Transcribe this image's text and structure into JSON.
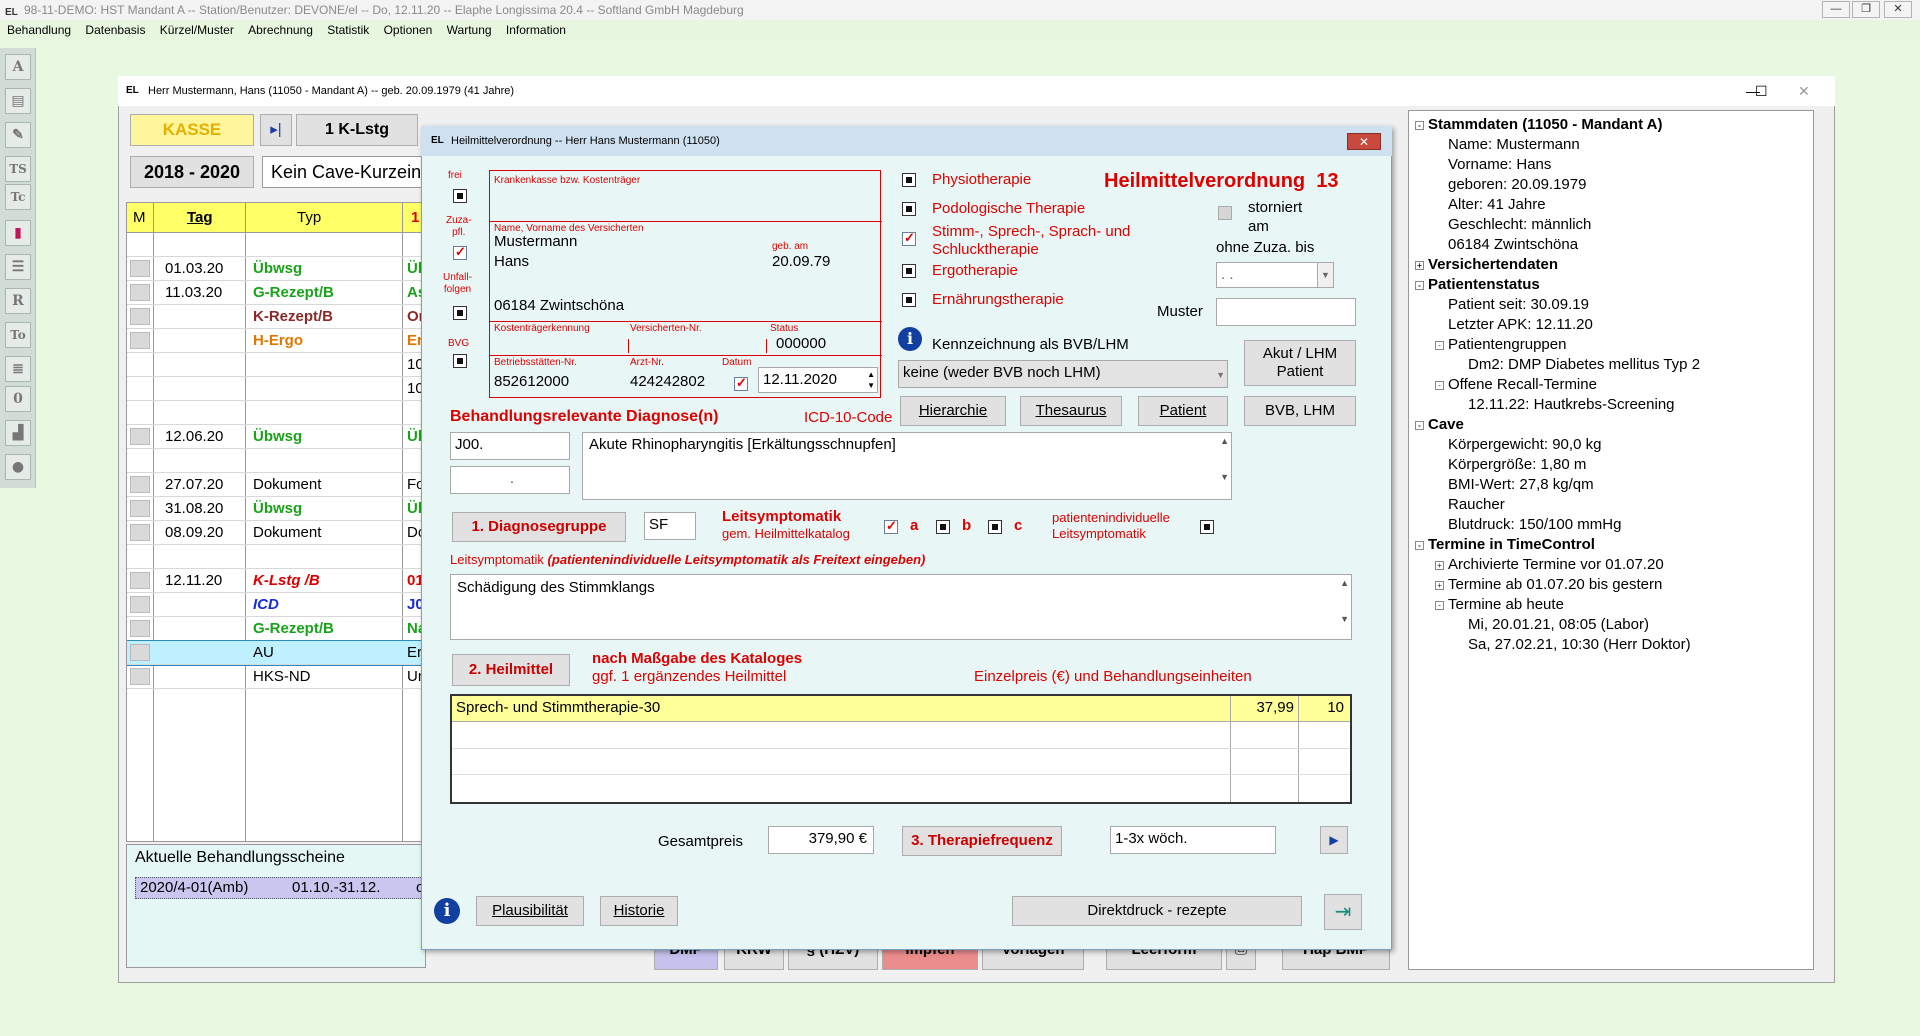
{
  "app": {
    "title": "98-11-DEMO: HST Mandant A -- Station/Benutzer: DEVONE/el -- Do, 12.11.20 -- Elaphe Longissima 20.4 -- Softland GmbH Magdeburg",
    "logo": "EL"
  },
  "menu": [
    "Behandlung",
    "Datenbasis",
    "Kürzel/Muster",
    "Abrechnung",
    "Statistik",
    "Optionen",
    "Wartung",
    "Information"
  ],
  "left_tools": [
    "A",
    "TS",
    "Tc",
    "R",
    "To",
    "0"
  ],
  "patient_window": {
    "title": "Herr Mustermann, Hans (11050 - Mandant A) -- geb. 20.09.1979 (41 Jahre)"
  },
  "top_buttons": {
    "kasse": "KASSE",
    "nav": "▸|",
    "klstg": "1 K-Lstg"
  },
  "years": "2018 - 2020",
  "cave": "Kein Cave-Kurzeintrag",
  "table": {
    "headers": [
      "M",
      "Tag",
      "Typ",
      "1"
    ],
    "rows": [
      {
        "tag": "",
        "typ": "",
        "c": ""
      },
      {
        "tag": "01.03.20",
        "typ": "Übwsg",
        "c": "Üb"
      },
      {
        "tag": "11.03.20",
        "typ": "G-Rezept/B",
        "c": "As"
      },
      {
        "tag": "",
        "typ": "K-Rezept/B",
        "c": "Or"
      },
      {
        "tag": "",
        "typ": "H-Ergo",
        "c": "Er"
      },
      {
        "tag": "",
        "typ": "",
        "c": "10"
      },
      {
        "tag": "",
        "typ": "",
        "c": "10"
      },
      {
        "tag": "",
        "typ": "",
        "c": ""
      },
      {
        "tag": "12.06.20",
        "typ": "Übwsg",
        "c": "Üb"
      },
      {
        "tag": "",
        "typ": "",
        "c": ""
      },
      {
        "tag": "27.07.20",
        "typ": "Dokument",
        "c": "Fo"
      },
      {
        "tag": "31.08.20",
        "typ": "Übwsg",
        "c": "Üb"
      },
      {
        "tag": "08.09.20",
        "typ": "Dokument",
        "c": "Do"
      },
      {
        "tag": "",
        "typ": "",
        "c": ""
      },
      {
        "tag": "12.11.20",
        "typ": "K-Lstg /B",
        "c": "01"
      },
      {
        "tag": "",
        "typ": "ICD",
        "c": "J0"
      },
      {
        "tag": "",
        "typ": "G-Rezept/B",
        "c": "Na"
      },
      {
        "tag": "",
        "typ": "AU",
        "c": "Er"
      },
      {
        "tag": "",
        "typ": "HKS-ND",
        "c": "Un"
      }
    ]
  },
  "scheine": {
    "label": "Aktuelle Behandlungsscheine",
    "value": "2020/4-01(Amb)",
    "range": "01.10.-31.12.",
    "extra": "ol"
  },
  "bottom_buttons": [
    "DMP",
    "KRW",
    "§ (HZV)",
    "Impfen",
    "Vorlagen",
    "Leerform",
    "",
    "Hap BMP"
  ],
  "dialog": {
    "title": "Heilmittelverordnung -- Herr Hans Mustermann (11050)",
    "frei": "frei",
    "zuza": "Zuza-\npfl.",
    "unfall": "Unfall-\nfolgen",
    "bvg": "BVG",
    "kk_label": "Krankenkasse bzw. Kostenträger",
    "name_label": "Name, Vorname des Versicherten",
    "lastname": "Mustermann",
    "firstname": "Hans",
    "geb_label": "geb. am",
    "geb": "20.09.79",
    "address": "06184 Zwintschöna",
    "ktk_label": "Kostenträgerkennung",
    "vnr_label": "Versicherten-Nr.",
    "status_label": "Status",
    "status": "000000",
    "bsnr_label": "Betriebsstätten-Nr.",
    "arzt_label": "Arzt-Nr.",
    "datum_label": "Datum",
    "bsnr": "852612000",
    "arzt": "424242802",
    "datum": "12.11.2020",
    "types": [
      "Physiotherapie",
      "Podologische Therapie",
      "Stimm-, Sprech-, Sprach- und Schlucktherapie",
      "Ergotherapie",
      "Ernährungstherapie"
    ],
    "heading": "Heilmittelverordnung",
    "heading_no": "13",
    "storniert": "storniert\nam",
    "ohne_zuza": "ohne Zuza. bis",
    "date_placeholder": ". .",
    "muster": "Muster",
    "kennz": "Kennzeichnung als BVB/LHM",
    "kennz_value": "keine (weder BVB noch LHM)",
    "akut": "Akut / LHM\nPatient",
    "hierarchie": "Hierarchie",
    "thesaurus": "Thesaurus",
    "patient_btn": "Patient",
    "bvb": "BVB, LHM",
    "diag_label": "Behandlungsrelevante Diagnose(n)",
    "icd_label": "ICD-10-Code",
    "icd1": "J00.",
    "icd2": ".",
    "diag_text": "Akute Rhinopharyngitis [Erkältungsschnupfen]",
    "diaggruppe": "1. Diagnosegruppe",
    "dg_value": "SF",
    "leit_label": "Leitsymptomatik",
    "leit_sub": "gem. Heilmittelkatalog",
    "a": "a",
    "b": "b",
    "c": "c",
    "pat_ind": "patientenindividuelle\nLeitsymptomatik",
    "leit_free_label": "Leitsymptomatik",
    "leit_free_hint": "(patientenindividuelle Leitsymptomatik als Freitext eingeben)",
    "leit_text": "Schädigung des Stimmklangs",
    "heilmittel_btn": "2. Heilmittel",
    "nach": "nach Maßgabe des Kataloges",
    "ggf": "ggf. 1 ergänzendes Heilmittel",
    "einzel": "Einzelpreis (€) und Behandlungseinheiten",
    "items": [
      {
        "name": "Sprech- und Stimmtherapie-30",
        "price": "37,99",
        "units": "10"
      }
    ],
    "gesamt_label": "Gesamtpreis",
    "gesamt": "379,90 €",
    "freq_btn": "3. Therapiefrequenz",
    "freq": "1-3x wöch.",
    "plaus": "Plausibilität",
    "historie": "Historie",
    "direkt": "Direktdruck - rezepte"
  },
  "tree": [
    {
      "l": 0,
      "t": "Stammdaten (11050 - Mandant A)",
      "b": true,
      "e": "-"
    },
    {
      "l": 1,
      "t": "Name: Mustermann"
    },
    {
      "l": 1,
      "t": "Vorname: Hans"
    },
    {
      "l": 1,
      "t": "geboren: 20.09.1979"
    },
    {
      "l": 1,
      "t": "Alter: 41 Jahre"
    },
    {
      "l": 1,
      "t": "Geschlecht: männlich"
    },
    {
      "l": 1,
      "t": "06184 Zwintschöna"
    },
    {
      "l": 0,
      "t": "Versichertendaten",
      "b": true,
      "e": "+"
    },
    {
      "l": 0,
      "t": "Patientenstatus",
      "b": true,
      "e": "-"
    },
    {
      "l": 1,
      "t": "Patient seit: 30.09.19"
    },
    {
      "l": 1,
      "t": "Letzter APK: 12.11.20"
    },
    {
      "l": 1,
      "t": "Patientengruppen",
      "e": "-"
    },
    {
      "l": 2,
      "t": "Dm2: DMP Diabetes mellitus Typ 2"
    },
    {
      "l": 1,
      "t": "Offene Recall-Termine",
      "e": "-"
    },
    {
      "l": 2,
      "t": "12.11.22: Hautkrebs-Screening"
    },
    {
      "l": 0,
      "t": "Cave",
      "b": true,
      "e": "-"
    },
    {
      "l": 1,
      "t": "Körpergewicht: 90,0 kg"
    },
    {
      "l": 1,
      "t": "Körpergröße: 1,80 m"
    },
    {
      "l": 1,
      "t": "BMI-Wert: 27,8 kg/qm"
    },
    {
      "l": 1,
      "t": "Raucher"
    },
    {
      "l": 1,
      "t": "Blutdruck: 150/100 mmHg"
    },
    {
      "l": 0,
      "t": "Termine in TimeControl",
      "b": true,
      "e": "-"
    },
    {
      "l": 1,
      "t": "Archivierte Termine vor 01.07.20",
      "e": "+"
    },
    {
      "l": 1,
      "t": "Termine ab 01.07.20 bis gestern",
      "e": "+"
    },
    {
      "l": 1,
      "t": "Termine ab heute",
      "e": "-"
    },
    {
      "l": 2,
      "t": "Mi, 20.01.21, 08:05 (Labor)"
    },
    {
      "l": 2,
      "t": "Sa, 27.02.21, 10:30 (Herr Doktor)"
    }
  ],
  "colors": {
    "app_bg": "#e8f8e1",
    "dialog_bg": "#e8f7f6",
    "accent_red": "#dd0000",
    "highlight_yellow": "#ffff99",
    "table_header": "#ffff66",
    "selected_row": "#bff0ff"
  }
}
